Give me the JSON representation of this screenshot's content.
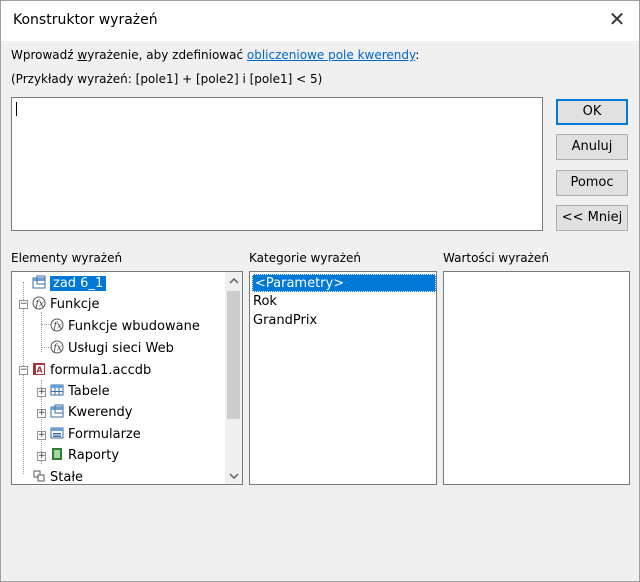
{
  "window": {
    "title": "Konstruktor wyrażeń"
  },
  "instructions": {
    "prefix": "Wprowadź ",
    "underlined": "w",
    "rest": "yrażenie, aby zdefiniować ",
    "link": "obliczeniowe pole kwerendy",
    "suffix": ":"
  },
  "examples": "(Przykłady wyrażeń: [pole1] + [pole2] i [pole1] < 5)",
  "expression": {
    "value": ""
  },
  "buttons": {
    "ok": "OK",
    "cancel": "Anuluj",
    "help": "Pomoc",
    "less": "<< Mniej"
  },
  "panels": {
    "elements_label": "Elementy wyrażeń",
    "categories_label": "Kategorie wyrażeń",
    "values_label": "Wartości wyrażeń"
  },
  "tree": [
    {
      "label": "zad 6_1",
      "icon": "query-icon",
      "selected": true
    },
    {
      "label": "Funkcje",
      "icon": "function-icon",
      "expander": "-"
    },
    {
      "label": "Funkcje wbudowane",
      "icon": "function-icon"
    },
    {
      "label": "Usługi sieci Web",
      "icon": "function-icon"
    },
    {
      "label": "formula1.accdb",
      "icon": "database-icon",
      "expander": "-"
    },
    {
      "label": "Tabele",
      "icon": "table-icon",
      "expander": "+"
    },
    {
      "label": "Kwerendy",
      "icon": "query-icon",
      "expander": "+"
    },
    {
      "label": "Formularze",
      "icon": "form-icon",
      "expander": "+"
    },
    {
      "label": "Raporty",
      "icon": "report-icon",
      "expander": "+"
    },
    {
      "label": "Stałe",
      "icon": "constant-icon"
    }
  ],
  "categories": [
    {
      "label": "<Parametry>",
      "selected": true
    },
    {
      "label": "Rok"
    },
    {
      "label": "GrandPrix"
    }
  ],
  "colors": {
    "accent": "#0078d7",
    "link": "#0066cc"
  }
}
